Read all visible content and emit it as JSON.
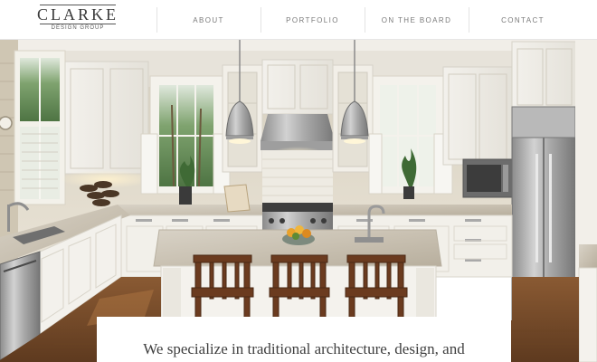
{
  "brand": {
    "name": "CLARKE",
    "tagline": "DESIGN GROUP"
  },
  "nav": {
    "items": [
      {
        "label": "ABOUT"
      },
      {
        "label": "PORTFOLIO"
      },
      {
        "label": "ON THE BOARD"
      },
      {
        "label": "CONTACT"
      }
    ]
  },
  "hero": {
    "image": "kitchen-photo"
  },
  "intro": {
    "text": "We specialize in traditional architecture, design, and"
  }
}
